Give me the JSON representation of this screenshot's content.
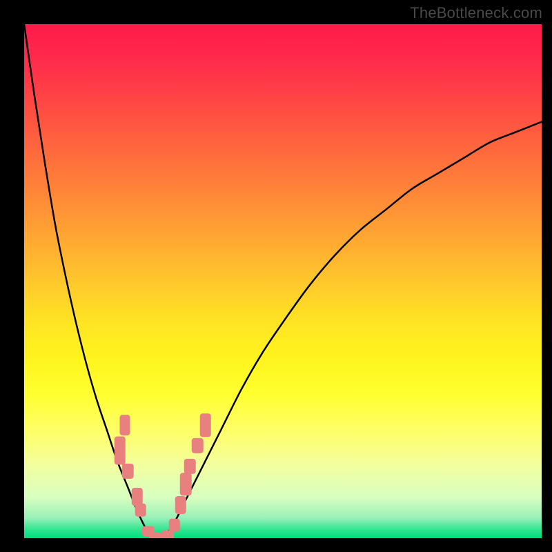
{
  "watermark": "TheBottleneck.com",
  "colors": {
    "frame": "#000000",
    "curve": "#000000",
    "dot": "#e98080"
  },
  "chart_data": {
    "type": "line",
    "title": "",
    "xlabel": "",
    "ylabel": "",
    "xlim": [
      0,
      100
    ],
    "ylim": [
      0,
      100
    ],
    "grid": false,
    "legend": false,
    "notes": "V-shaped bottleneck curve on rainbow gradient; y≈0 at x≈24–27; salmon markers cluster near the valley along both branches.",
    "series": [
      {
        "name": "left-branch",
        "x": [
          0,
          2,
          4,
          6,
          8,
          10,
          12,
          14,
          16,
          18,
          20,
          22,
          24,
          25
        ],
        "y": [
          100,
          86,
          73,
          61,
          51,
          42,
          34,
          27,
          21,
          15,
          10,
          5,
          1,
          0
        ]
      },
      {
        "name": "right-branch",
        "x": [
          27,
          29,
          31,
          34,
          38,
          42,
          46,
          50,
          55,
          60,
          65,
          70,
          75,
          80,
          85,
          90,
          95,
          100
        ],
        "y": [
          0,
          3,
          7,
          13,
          21,
          29,
          36,
          42,
          49,
          55,
          60,
          64,
          68,
          71,
          74,
          77,
          79,
          81
        ]
      }
    ],
    "markers": [
      {
        "x": 18.5,
        "y": 17,
        "w": 2.2,
        "h": 5.5
      },
      {
        "x": 19.5,
        "y": 22,
        "w": 2.0,
        "h": 4.0
      },
      {
        "x": 20.0,
        "y": 13,
        "w": 2.2,
        "h": 3.0
      },
      {
        "x": 21.8,
        "y": 8,
        "w": 2.2,
        "h": 3.5
      },
      {
        "x": 22.5,
        "y": 5.5,
        "w": 2.2,
        "h": 2.5
      },
      {
        "x": 24.0,
        "y": 1.3,
        "w": 2.4,
        "h": 2.0
      },
      {
        "x": 25.3,
        "y": 0.3,
        "w": 2.4,
        "h": 1.6
      },
      {
        "x": 27.7,
        "y": 0.5,
        "w": 2.4,
        "h": 2.0
      },
      {
        "x": 29.0,
        "y": 2.5,
        "w": 2.2,
        "h": 2.5
      },
      {
        "x": 30.2,
        "y": 6.5,
        "w": 2.2,
        "h": 3.5
      },
      {
        "x": 31.2,
        "y": 10.5,
        "w": 2.2,
        "h": 4.5
      },
      {
        "x": 32.0,
        "y": 14,
        "w": 2.2,
        "h": 3.0
      },
      {
        "x": 33.5,
        "y": 18,
        "w": 2.2,
        "h": 3.0
      },
      {
        "x": 35.0,
        "y": 22,
        "w": 2.2,
        "h": 4.5
      }
    ]
  }
}
